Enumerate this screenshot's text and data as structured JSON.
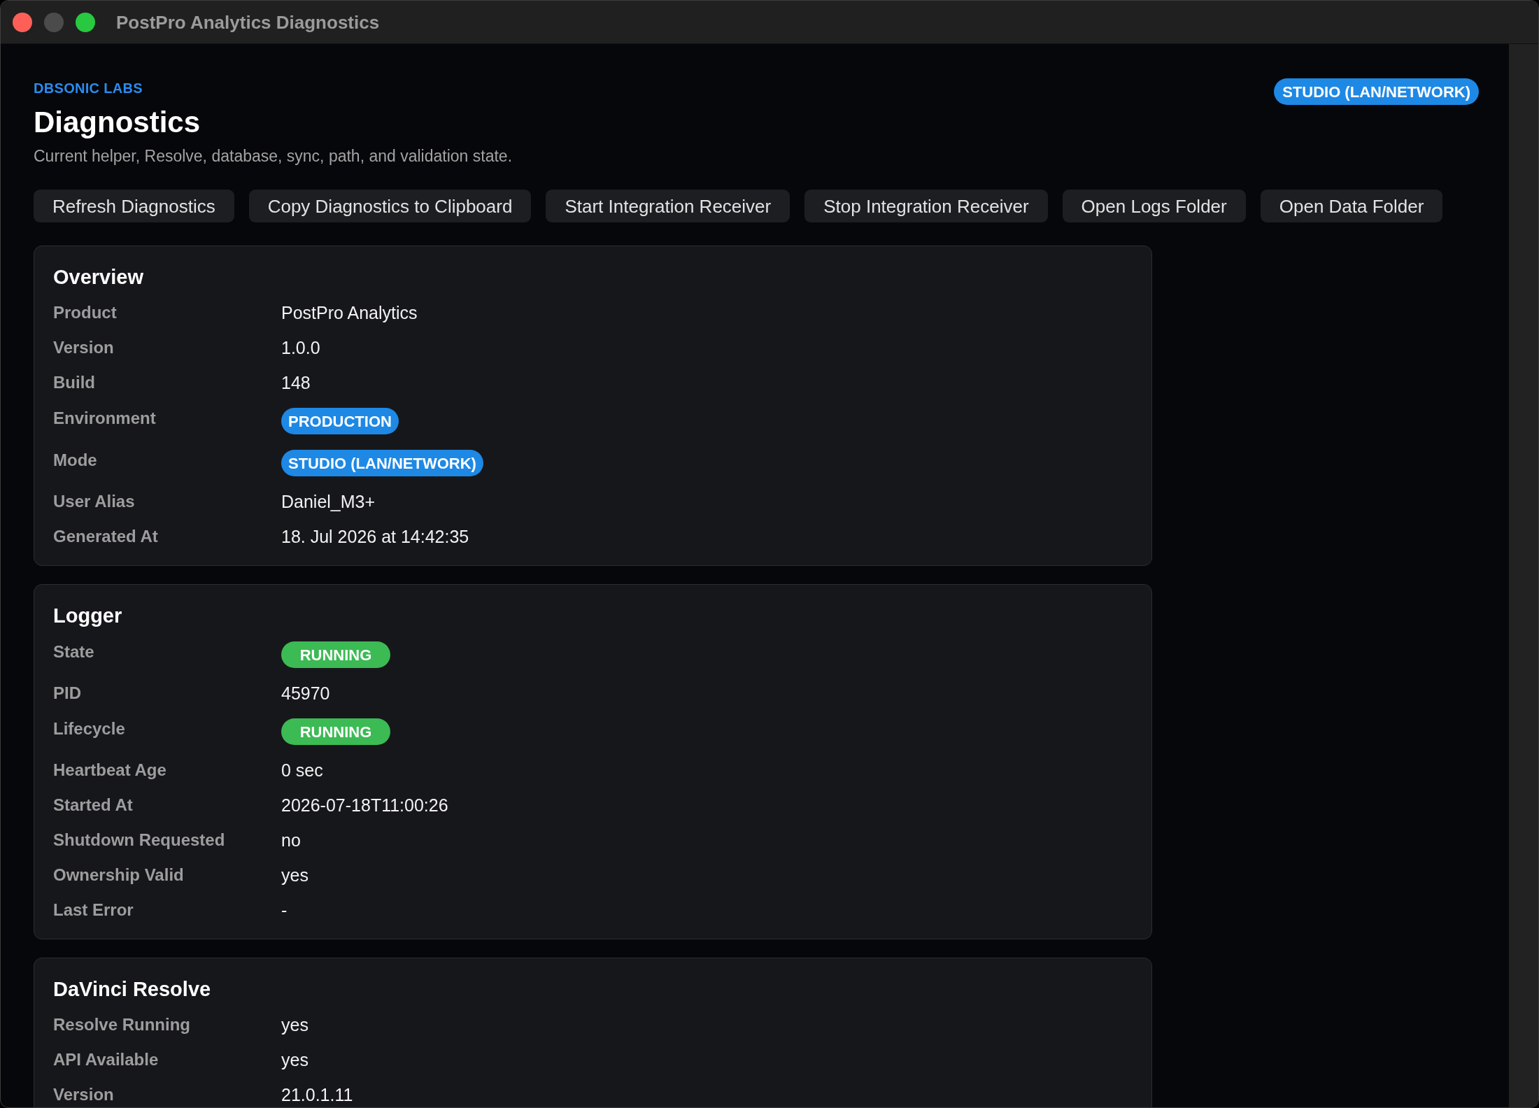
{
  "window": {
    "title": "PostPro Analytics Diagnostics",
    "controls": [
      {
        "kind": "close",
        "disabled": false
      },
      {
        "kind": "minimize",
        "disabled": true
      },
      {
        "kind": "zoom",
        "disabled": false
      }
    ]
  },
  "header": {
    "brand": "DBSONIC LABS",
    "title": "Diagnostics",
    "subtitle": "Current helper, Resolve, database, sync, path, and validation state.",
    "mode_badge": {
      "text": "STUDIO (LAN/NETWORK)",
      "color": "#1e88e5"
    }
  },
  "toolbar": {
    "buttons": [
      "Refresh Diagnostics",
      "Copy Diagnostics to Clipboard",
      "Start Integration Receiver",
      "Stop Integration Receiver",
      "Open Logs Folder",
      "Open Data Folder"
    ]
  },
  "sections": [
    {
      "title": "Overview",
      "rows": [
        {
          "kind": "text",
          "label": "Product",
          "value": "PostPro Analytics"
        },
        {
          "kind": "text",
          "label": "Version",
          "value": "1.0.0"
        },
        {
          "kind": "text",
          "label": "Build",
          "value": "148"
        },
        {
          "kind": "badge",
          "label": "Environment",
          "value": "PRODUCTION",
          "color": "#1e88e5"
        },
        {
          "kind": "badge",
          "label": "Mode",
          "value": "STUDIO (LAN/NETWORK)",
          "color": "#1e88e5"
        },
        {
          "kind": "text",
          "label": "User Alias",
          "value": "Daniel_M3+"
        },
        {
          "kind": "text",
          "label": "Generated At",
          "value": "18. Jul 2026 at 14:42:35"
        }
      ]
    },
    {
      "title": "Logger",
      "rows": [
        {
          "kind": "badge",
          "label": "State",
          "value": "RUNNING",
          "color": "#3cba54"
        },
        {
          "kind": "text",
          "label": "PID",
          "value": "45970"
        },
        {
          "kind": "badge",
          "label": "Lifecycle",
          "value": "RUNNING",
          "color": "#3cba54"
        },
        {
          "kind": "text",
          "label": "Heartbeat Age",
          "value": "0 sec"
        },
        {
          "kind": "text",
          "label": "Started At",
          "value": "2026-07-18T11:00:26"
        },
        {
          "kind": "text",
          "label": "Shutdown Requested",
          "value": "no"
        },
        {
          "kind": "text",
          "label": "Ownership Valid",
          "value": "yes"
        },
        {
          "kind": "text",
          "label": "Last Error",
          "value": "-"
        }
      ]
    },
    {
      "title": "DaVinci Resolve",
      "rows": [
        {
          "kind": "text",
          "label": "Resolve Running",
          "value": "yes"
        },
        {
          "kind": "text",
          "label": "API Available",
          "value": "yes"
        },
        {
          "kind": "text",
          "label": "Version",
          "value": "21.0.1.11"
        }
      ]
    }
  ]
}
